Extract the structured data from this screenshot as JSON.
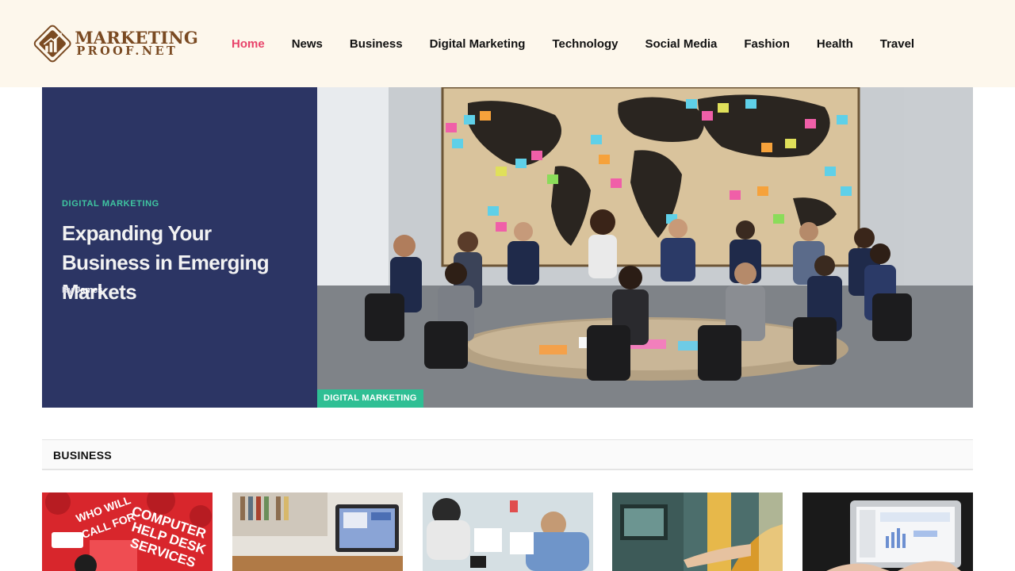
{
  "brand": {
    "line1": "MARKETING",
    "line2": "PROOF.NET",
    "colors": {
      "brown": "#7a4a22",
      "cream": "#fdf7ec"
    }
  },
  "nav": {
    "items": [
      {
        "label": "Home",
        "active": true
      },
      {
        "label": "News"
      },
      {
        "label": "Business"
      },
      {
        "label": "Digital Marketing"
      },
      {
        "label": "Technology"
      },
      {
        "label": "Social Media"
      },
      {
        "label": "Fashion"
      },
      {
        "label": "Health"
      },
      {
        "label": "Travel"
      }
    ],
    "active_color": "#e8436a"
  },
  "hero": {
    "category": "DIGITAL MARKETING",
    "title": "Expanding Your Business in Emerging Markets",
    "by": "By",
    "author": "James",
    "image_badge": "DIGITAL MARKETING",
    "panel_color": "#2c3564",
    "accent": "#2fbf94",
    "image_icon": "boardroom-photo"
  },
  "section": {
    "title": "BUSINESS"
  },
  "thumbs": [
    {
      "icon": "help-desk-banner-photo",
      "text_a": "WHO WILL",
      "text_b": "YOU CALL FOR",
      "text_c": "COMPUTER",
      "text_d": "HELP DESK",
      "text_e": "SERVICES"
    },
    {
      "icon": "laptop-desk-photo"
    },
    {
      "icon": "meeting-table-photo"
    },
    {
      "icon": "atm-photo"
    },
    {
      "icon": "laptop-analytics-photo"
    }
  ]
}
